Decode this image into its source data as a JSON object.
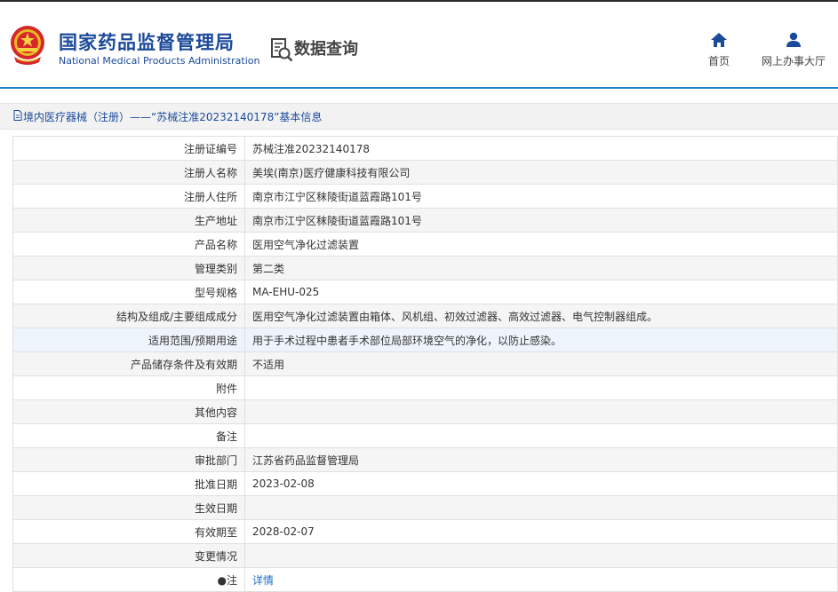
{
  "header": {
    "logo_cn": "国家药品监督管理局",
    "logo_en": "National Medical Products Administration",
    "query_title": "数据查询",
    "nav": [
      {
        "label": "首页",
        "icon": "home-icon"
      },
      {
        "label": "网上办事大厅",
        "icon": "user-icon"
      }
    ]
  },
  "breadcrumb": {
    "text": "境内医疗器械（注册）——“苏械注准20232140178”基本信息"
  },
  "colors": {
    "brand_blue": "#1c4a9a",
    "accent_line": "#1e7fc7",
    "link": "#1c6fc9"
  },
  "rows": [
    {
      "label": "注册证编号",
      "value": "苏械注准20232140178"
    },
    {
      "label": "注册人名称",
      "value": "美埃(南京)医疗健康科技有限公司"
    },
    {
      "label": "注册人住所",
      "value": "南京市江宁区秣陵街道蓝霞路101号"
    },
    {
      "label": "生产地址",
      "value": "南京市江宁区秣陵街道蓝霞路101号"
    },
    {
      "label": "产品名称",
      "value": "医用空气净化过滤装置"
    },
    {
      "label": "管理类别",
      "value": "第二类"
    },
    {
      "label": "型号规格",
      "value": "MA-EHU-025"
    },
    {
      "label": "结构及组成/主要组成成分",
      "value": "医用空气净化过滤装置由箱体、风机组、初效过滤器、高效过滤器、电气控制器组成。"
    },
    {
      "label": "适用范围/预期用途",
      "value": "用于手术过程中患者手术部位局部环境空气的净化，以防止感染。"
    },
    {
      "label": "产品储存条件及有效期",
      "value": "不适用"
    },
    {
      "label": "附件",
      "value": ""
    },
    {
      "label": "其他内容",
      "value": ""
    },
    {
      "label": "备注",
      "value": ""
    },
    {
      "label": "审批部门",
      "value": "江苏省药品监督管理局"
    },
    {
      "label": "批准日期",
      "value": "2023-02-08"
    },
    {
      "label": "生效日期",
      "value": ""
    },
    {
      "label": "有效期至",
      "value": "2028-02-07"
    },
    {
      "label": "变更情况",
      "value": ""
    },
    {
      "label": "●注",
      "value": "详情"
    }
  ]
}
